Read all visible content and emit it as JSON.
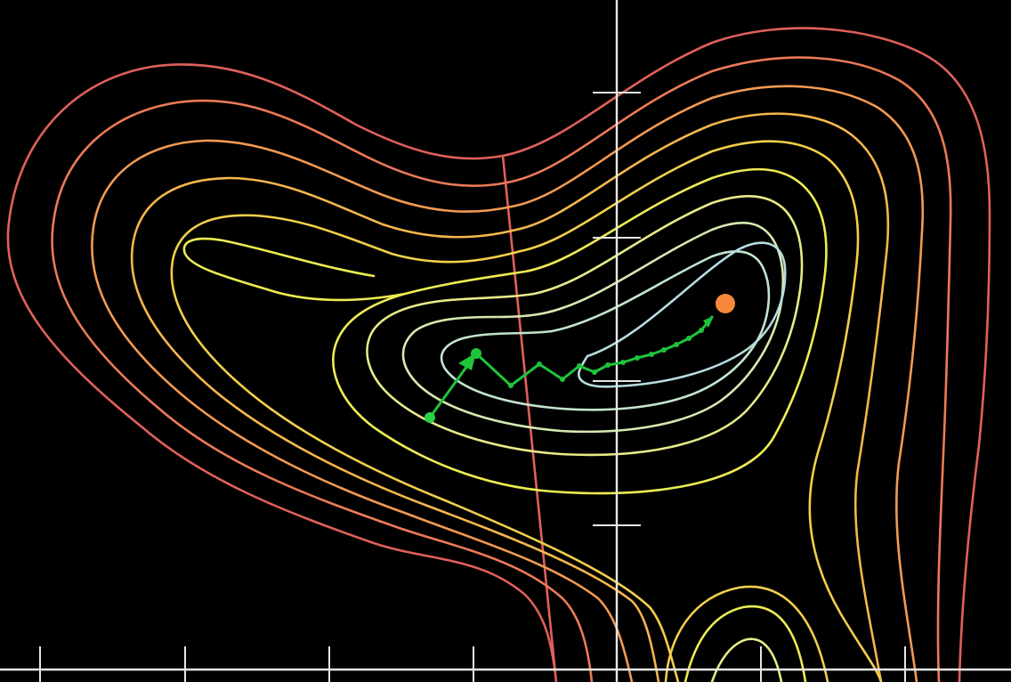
{
  "figure": {
    "background": "#000000",
    "axis_color": "#e6e6e6",
    "contour_colors": {
      "outer": "#e0605a",
      "orange_red": "#ec7a58",
      "orange": "#f29a52",
      "amber": "#f5b74c",
      "gold": "#f2cf4a",
      "yellow": "#ecec52",
      "light_yellow": "#e8ea88",
      "pale": "#d6e9b0",
      "mint": "#c3e4cc",
      "ice": "#b6dce0"
    },
    "path_color": "#1ec43a",
    "minimum_marker_color": "#f7883a",
    "start_marker_color": "#2bd24a"
  },
  "icons": {
    "start_point": "start-point-dot",
    "first_step": "arrow-head",
    "minimum": "minimum-dot"
  }
}
